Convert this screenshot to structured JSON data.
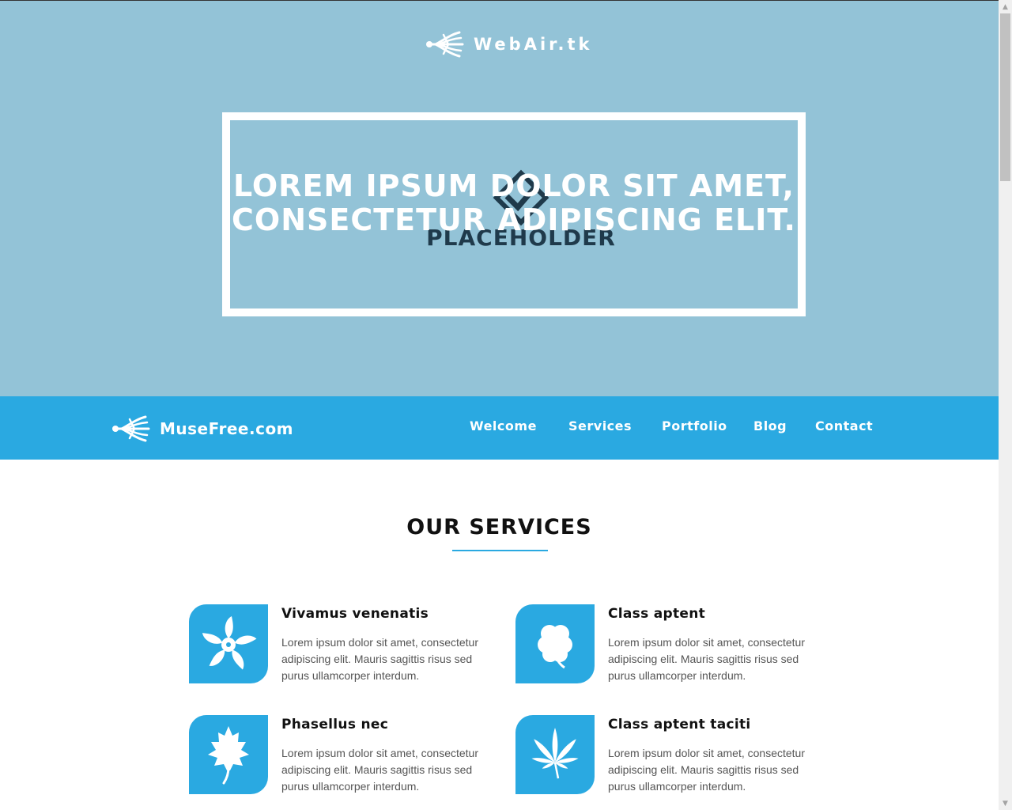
{
  "hero": {
    "logo_text": "WebAir.tk",
    "heading": "LOREM IPSUM DOLOR SIT AMET, CONSECTETUR ADIPISCING ELIT.",
    "placeholder_text": "PLACEHOLDER"
  },
  "navbar": {
    "brand": "MuseFree.com",
    "items": [
      {
        "label": "Welcome"
      },
      {
        "label": "Services"
      },
      {
        "label": "Portfolio"
      },
      {
        "label": "Blog"
      },
      {
        "label": "Contact"
      }
    ]
  },
  "services": {
    "title": "OUR SERVICES",
    "items": [
      {
        "icon": "flower-icon",
        "title": "Vivamus venenatis",
        "description": "Lorem ipsum dolor sit amet, consectetur adipiscing elit. Mauris sagittis risus sed purus ullamcorper interdum."
      },
      {
        "icon": "clover-icon",
        "title": "Class aptent",
        "description": "Lorem ipsum dolor sit amet, consectetur adipiscing elit. Mauris sagittis risus sed purus ullamcorper interdum."
      },
      {
        "icon": "leaf-icon",
        "title": "Phasellus nec",
        "description": "Lorem ipsum dolor sit amet, consectetur adipiscing elit. Mauris sagittis risus sed purus ullamcorper interdum."
      },
      {
        "icon": "cannabis-leaf-icon",
        "title": "Class aptent taciti",
        "description": "Lorem ipsum dolor sit amet, consectetur adipiscing elit. Mauris sagittis risus sed purus ullamcorper interdum."
      }
    ]
  },
  "colors": {
    "hero_bg": "#93c3d7",
    "accent": "#2aa9e1",
    "text_dark": "#111111",
    "text_body": "#555555"
  }
}
